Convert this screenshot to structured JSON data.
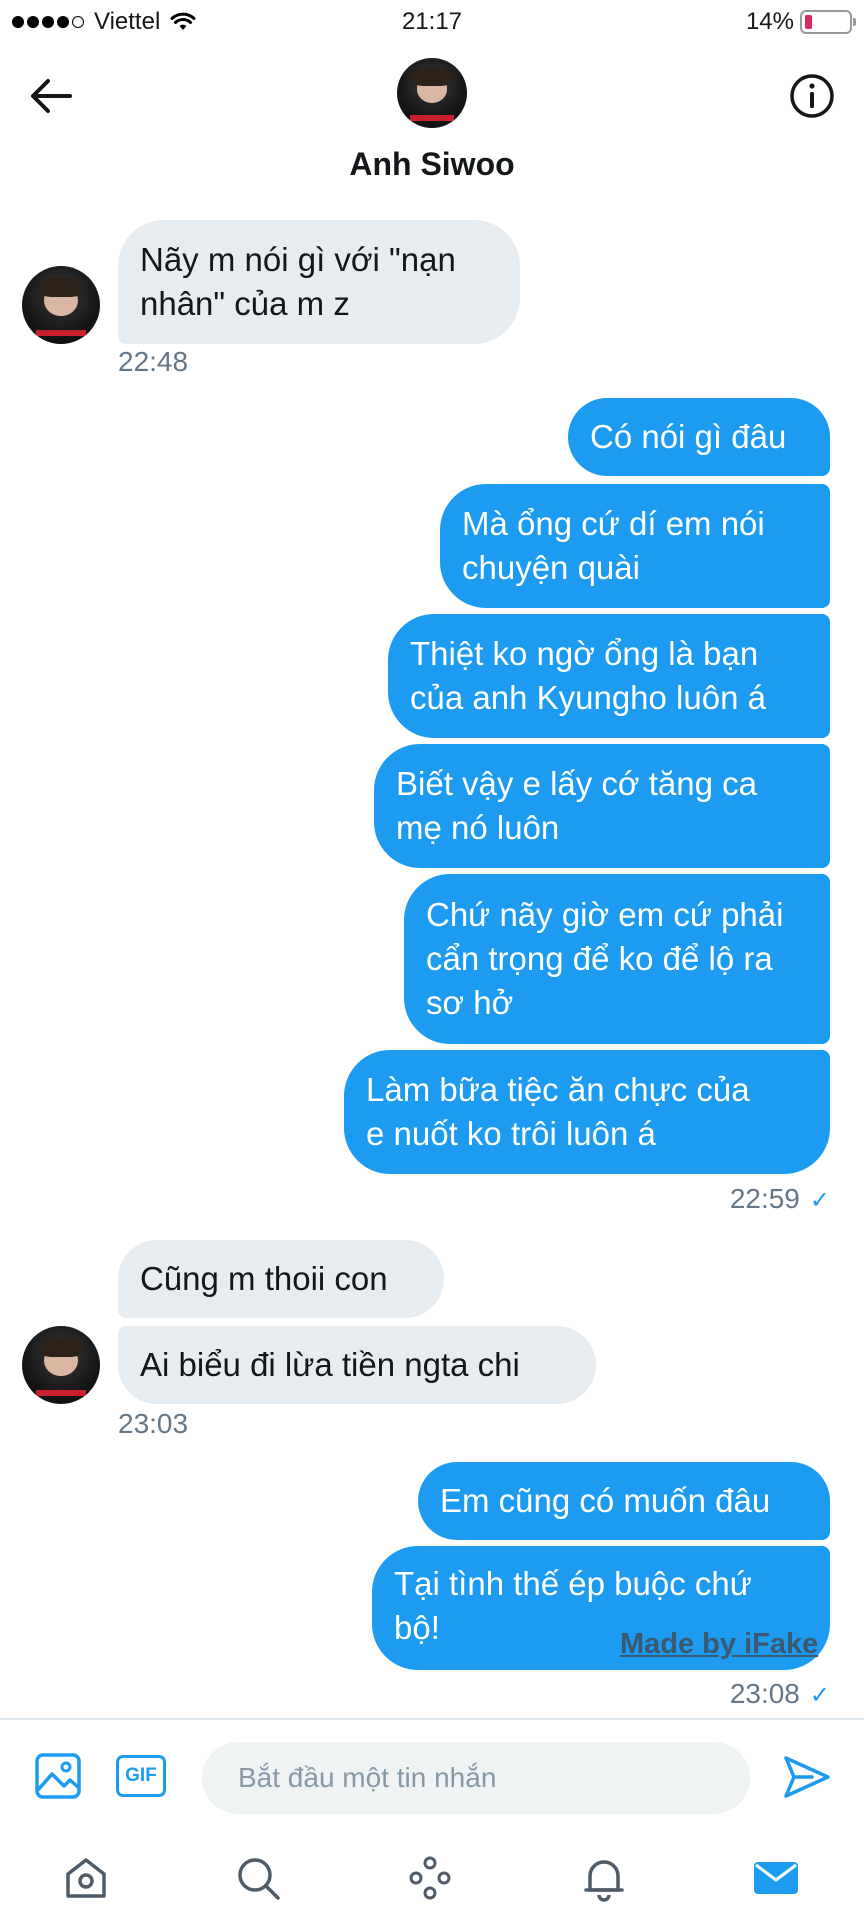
{
  "status_bar": {
    "carrier": "Viettel",
    "time": "21:17",
    "battery": "14%"
  },
  "header": {
    "contact_name": "Anh Siwoo"
  },
  "messages": [
    {
      "side": "in",
      "lines": [
        "Nãy m nói gì với \"nạn",
        "nhân\" của m z"
      ]
    },
    {
      "side": "in_time",
      "time": "22:48"
    },
    {
      "side": "out",
      "lines": [
        "Có nói gì đâu"
      ]
    },
    {
      "side": "out",
      "lines": [
        "Mà ổng cứ dí em nói",
        "chuyện quài"
      ]
    },
    {
      "side": "out",
      "lines": [
        "Thiệt ko ngờ ổng là bạn",
        "của anh Kyungho luôn á"
      ]
    },
    {
      "side": "out",
      "lines": [
        "Biết vậy e lấy cớ tăng ca",
        "mẹ nó luôn"
      ]
    },
    {
      "side": "out",
      "lines": [
        "Chứ nãy giờ em cứ phải",
        "cẩn trọng để ko để lộ ra",
        "sơ hở"
      ]
    },
    {
      "side": "out",
      "lines": [
        "Làm bữa tiệc ăn chực của",
        "e nuốt ko trôi luôn á"
      ]
    },
    {
      "side": "out_time",
      "time": "22:59",
      "check": "✓"
    },
    {
      "side": "in",
      "lines": [
        "Cũng m thoii con"
      ]
    },
    {
      "side": "in",
      "lines": [
        "Ai biểu đi lừa tiền ngta chi"
      ]
    },
    {
      "side": "in_time",
      "time": "23:03"
    },
    {
      "side": "out",
      "lines": [
        "Em cũng có muốn đâu"
      ]
    },
    {
      "side": "out",
      "lines": [
        "Tại tình thế ép buộc chứ",
        "bộ!"
      ]
    },
    {
      "side": "out_time",
      "time": "23:08",
      "check": "✓"
    }
  ],
  "watermark": "Made by iFake",
  "composer": {
    "gif_label": "GIF",
    "placeholder": "Bắt đầu một tin nhắn"
  },
  "icons": {
    "back": "arrow-left-icon",
    "info": "info-icon",
    "media": "image-icon",
    "send": "send-icon",
    "tabs": [
      "home-icon",
      "search-icon",
      "spaces-icon",
      "notifications-icon",
      "messages-icon"
    ]
  },
  "colors": {
    "accent": "#1d9bf0",
    "incoming_bubble": "#e6ecf0",
    "battery_low": "#e0245e"
  }
}
